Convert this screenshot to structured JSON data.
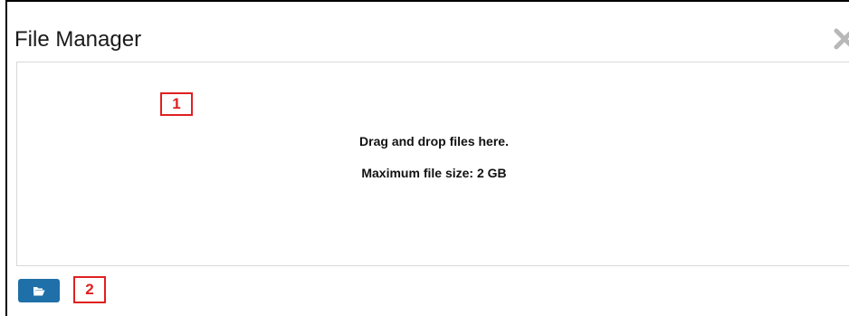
{
  "dialog": {
    "title": "File Manager",
    "close_icon": "close-icon"
  },
  "drop_zone": {
    "line1": "Drag and drop files here.",
    "line2": "Maximum file size: 2 GB"
  },
  "browse_button": {
    "icon": "folder-open-icon",
    "color": "#1f6fa8"
  },
  "annotations": {
    "marker1": "1",
    "marker2": "2",
    "color": "#e02020"
  }
}
